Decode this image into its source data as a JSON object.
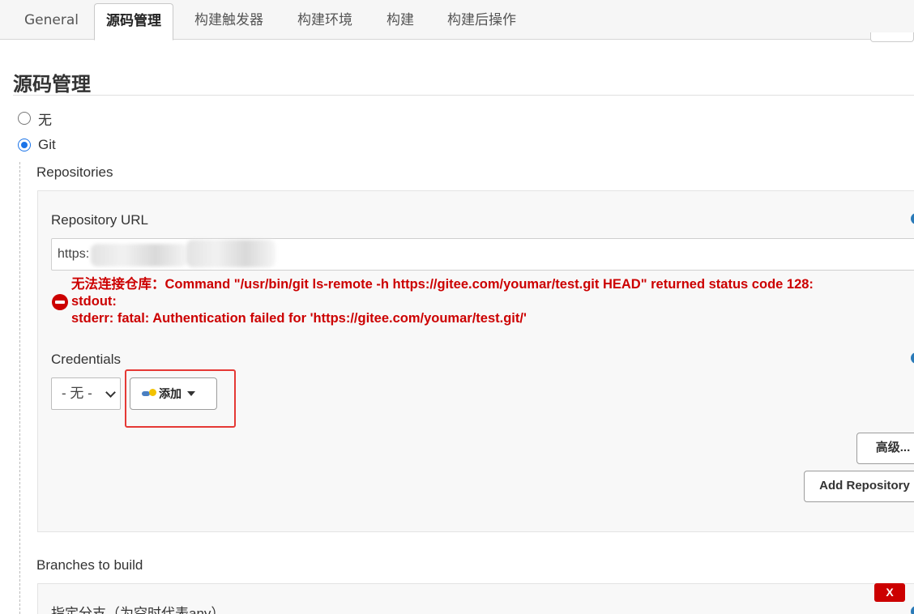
{
  "tabs": [
    {
      "label": "General"
    },
    {
      "label": "源码管理"
    },
    {
      "label": "构建触发器"
    },
    {
      "label": "构建环境"
    },
    {
      "label": "构建"
    },
    {
      "label": "构建后操作"
    }
  ],
  "section": {
    "title": "源码管理",
    "radio_none_label": "无",
    "radio_git_label": "Git"
  },
  "repositories": {
    "label": "Repositories",
    "url_label": "Repository URL",
    "url_value_visible": "https:",
    "error_text": "无法连接仓库：Command \"/usr/bin/git ls-remote -h https://gitee.com/youmar/test.git HEAD\" returned status code 128:\nstdout:\nstderr: fatal: Authentication failed for 'https://gitee.com/youmar/test.git/'",
    "credentials_label": "Credentials",
    "credentials_selected": "- 无 -",
    "add_button_label": "添加",
    "advanced_button_label": "高级...",
    "add_repository_button_label": "Add Repository"
  },
  "branches": {
    "label": "Branches to build",
    "spec_label": "指定分支（为空时代表any）",
    "delete_label": "X"
  },
  "colors": {
    "error": "#cc0000",
    "accent": "#1a73e8",
    "highlight": "#e53935"
  }
}
